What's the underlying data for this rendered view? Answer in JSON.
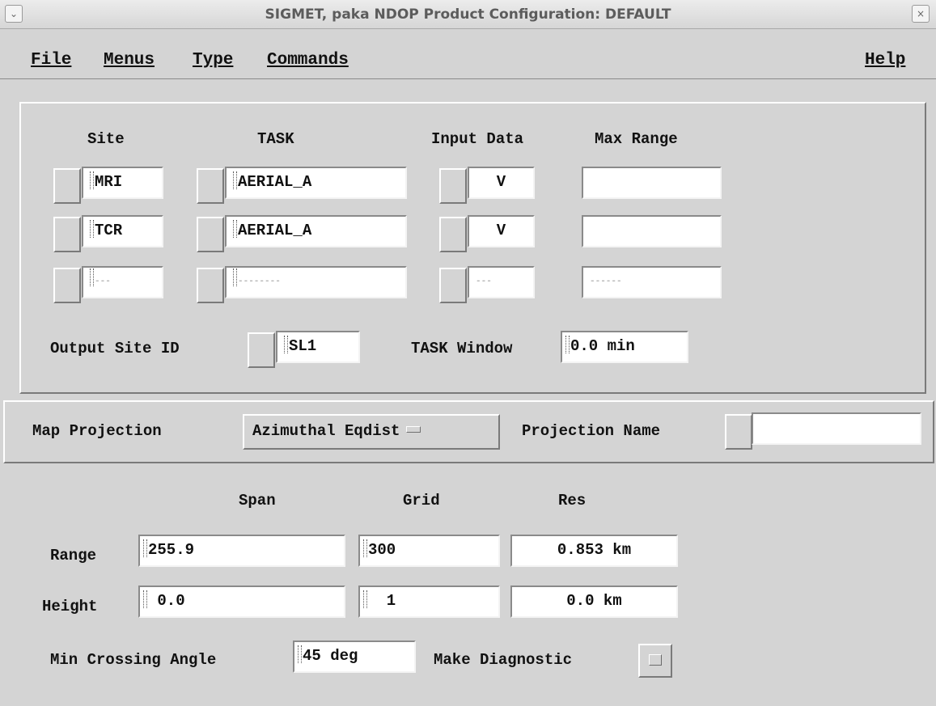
{
  "window": {
    "title": "SIGMET, paka  NDOP Product Configuration: DEFAULT"
  },
  "menubar": {
    "file": "File",
    "menus": "Menus",
    "type": "Type",
    "commands": "Commands",
    "help": "Help"
  },
  "sites": {
    "headers": {
      "site": "Site",
      "task": "TASK",
      "input_data": "Input Data",
      "max_range": "Max Range"
    },
    "rows": [
      {
        "site": "MRI",
        "task": "AERIAL_A",
        "input": "V",
        "max_range": ""
      },
      {
        "site": "TCR",
        "task": "AERIAL_A",
        "input": "V",
        "max_range": ""
      },
      {
        "site": "---",
        "task": "--------",
        "input": "---",
        "max_range": "------"
      }
    ],
    "output_site_label": "Output Site ID",
    "output_site_value": "SL1",
    "task_window_label": "TASK Window",
    "task_window_value": "0.0 min"
  },
  "projection": {
    "label": "Map Projection",
    "value": "Azimuthal Eqdist",
    "name_label": "Projection Name",
    "name_value": ""
  },
  "grid": {
    "headers": {
      "span": "Span",
      "grid": "Grid",
      "res": "Res"
    },
    "range": {
      "label": "Range",
      "span": "255.9",
      "grid": "300",
      "res": "0.853 km"
    },
    "height": {
      "label": "Height",
      "span": " 0.0",
      "grid": "  1",
      "res": "0.0 km"
    },
    "min_crossing_label": "Min Crossing Angle",
    "min_crossing_value": "45 deg",
    "make_diagnostic_label": "Make Diagnostic"
  }
}
